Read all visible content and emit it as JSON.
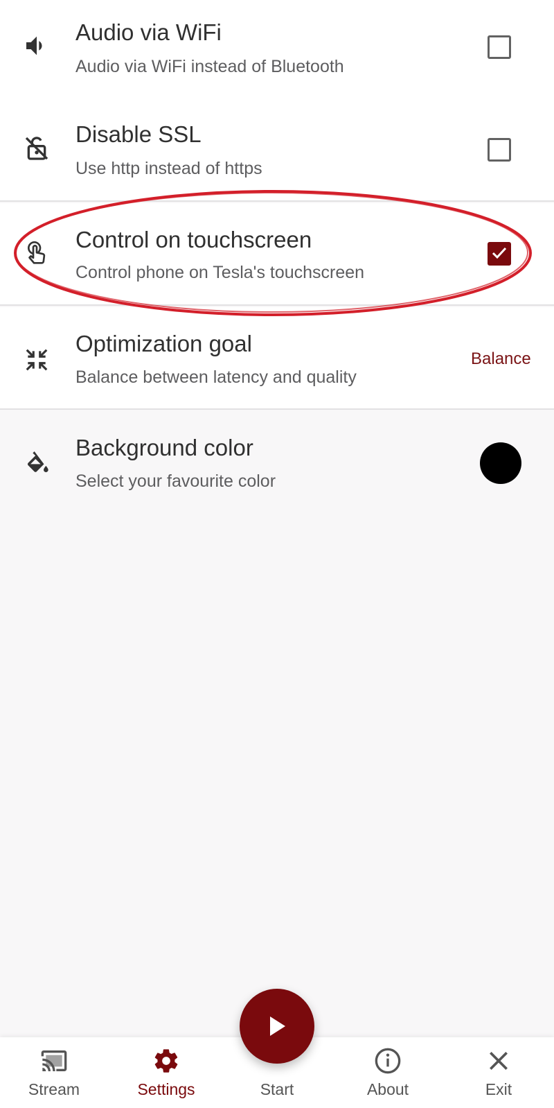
{
  "settings": {
    "items": [
      {
        "icon": "volume-icon",
        "title": "Audio via WiFi",
        "subtitle": "Audio via WiFi instead of Bluetooth",
        "control": "checkbox",
        "checked": false
      },
      {
        "icon": "lock-off-icon",
        "title": "Disable SSL",
        "subtitle": "Use http instead of https",
        "control": "checkbox",
        "checked": false
      },
      {
        "icon": "touch-icon",
        "title": "Control on touchscreen",
        "subtitle": "Control phone on Tesla's touchscreen",
        "control": "checkbox",
        "checked": true
      },
      {
        "icon": "compress-icon",
        "title": "Optimization goal",
        "subtitle": "Balance between latency and quality",
        "control": "value",
        "value": "Balance"
      },
      {
        "icon": "paint-bucket-icon",
        "title": "Background color",
        "subtitle": "Select your favourite color",
        "control": "color",
        "color": "#000000"
      }
    ]
  },
  "bottom_nav": {
    "items": [
      {
        "icon": "cast-icon",
        "label": "Stream",
        "active": false
      },
      {
        "icon": "gear-icon",
        "label": "Settings",
        "active": true
      },
      {
        "icon": "play-icon",
        "label": "Start",
        "active": false
      },
      {
        "icon": "info-icon",
        "label": "About",
        "active": false
      },
      {
        "icon": "close-icon",
        "label": "Exit",
        "active": false
      }
    ]
  },
  "colors": {
    "accent": "#7a0a0d",
    "highlight_ring": "#d31f2a",
    "divider": "#e2e1e3",
    "title_text": "#303030",
    "subtitle_text": "#5d5d5f"
  }
}
